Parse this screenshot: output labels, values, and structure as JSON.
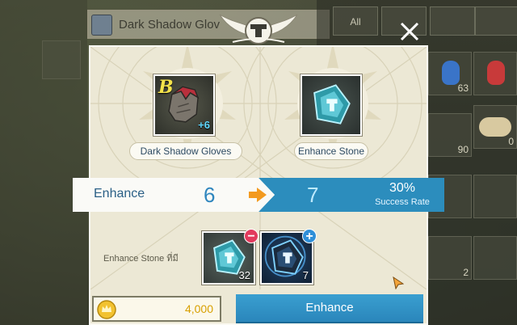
{
  "background": {
    "title": "Dark Shadow Glov",
    "tab_all": "All",
    "counts": [
      "63",
      "90",
      "0",
      "2"
    ]
  },
  "item": {
    "name": "Dark Shadow Gloves",
    "grade": "B",
    "plus": "+6"
  },
  "stone": {
    "name": "Enhance Stone"
  },
  "enhance_bar": {
    "label": "Enhance",
    "current_level": "6",
    "next_level": "7",
    "rate": "30%",
    "rate_label": "Success Rate"
  },
  "materials": {
    "label": "Enhance Stone ที่มี",
    "slot1_count": "32",
    "slot2_count": "7",
    "minus": "−",
    "plus": "+"
  },
  "gold": {
    "amount": "4,000"
  },
  "actions": {
    "enhance_button": "Enhance"
  },
  "colors": {
    "accent_blue": "#2c8dbd",
    "gold": "#d8a000",
    "parchment": "#ece8d5",
    "minus_badge": "#e23a5d",
    "plus_badge": "#2f8fd8"
  },
  "icons": [
    "winged-anvil-crest-icon",
    "close-icon",
    "gloves-icon",
    "enhance-stone-icon",
    "arrow-right-icon",
    "gold-coin-icon",
    "cursor-icon"
  ]
}
